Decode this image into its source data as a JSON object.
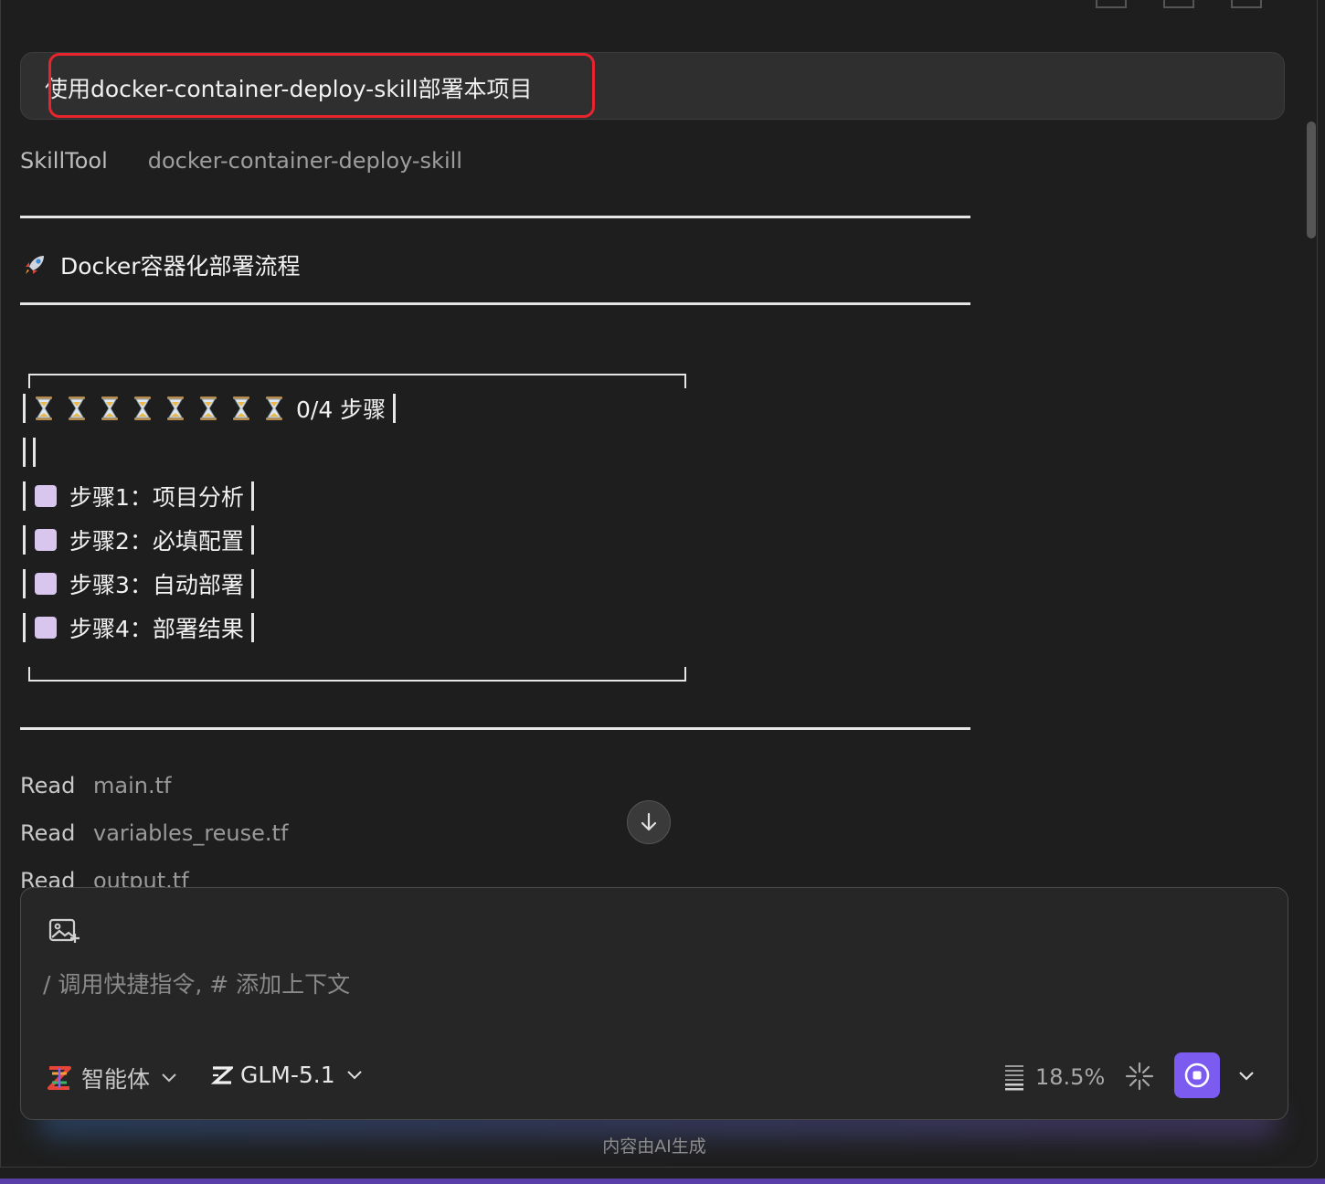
{
  "user_message": {
    "text": "使用docker-container-deploy-skill部署本项目"
  },
  "tool_call": {
    "name": "SkillTool",
    "arg": "docker-container-deploy-skill"
  },
  "heading": {
    "text": "Docker容器化部署流程"
  },
  "progress": {
    "hourglass_count": 8,
    "summary": "0/4 步骤",
    "steps": [
      {
        "label": "步骤1：项目分析",
        "done": false
      },
      {
        "label": "步骤2：必填配置",
        "done": false
      },
      {
        "label": "步骤3：自动部署",
        "done": false
      },
      {
        "label": "步骤4：部署结果",
        "done": false
      }
    ]
  },
  "reads": [
    {
      "label": "Read",
      "file": "main.tf"
    },
    {
      "label": "Read",
      "file": "variables_reuse.tf"
    },
    {
      "label": "Read",
      "file": "output.tf"
    }
  ],
  "composer": {
    "placeholder": "/ 调用快捷指令, # 添加上下文",
    "agent_label": "智能体",
    "model_label": "GLM-5.1",
    "context_usage": "18.5%"
  },
  "footer": {
    "note": "内容由AI生成"
  },
  "colors": {
    "accent": "#7c5cf0",
    "highlight": "#e8242c",
    "checkbox": "#d8c6ee"
  }
}
